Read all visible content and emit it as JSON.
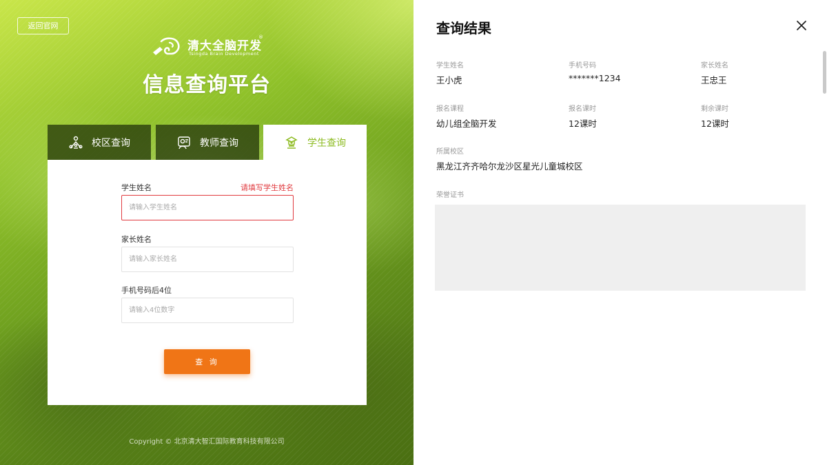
{
  "left": {
    "back_button": "返回官网",
    "logo": {
      "text": "清大全脑开发",
      "subtext": "Tsingda Brain Development",
      "reg_mark": "®"
    },
    "title": "信息查询平台",
    "tabs": [
      {
        "label": "校区查询",
        "icon": "campus-icon",
        "active": false
      },
      {
        "label": "教师查询",
        "icon": "teacher-icon",
        "active": false
      },
      {
        "label": "学生查询",
        "icon": "student-icon",
        "active": true
      }
    ],
    "form": {
      "student_name": {
        "label": "学生姓名",
        "error": "请填写学生姓名",
        "placeholder": "请输入学生姓名",
        "value": ""
      },
      "parent_name": {
        "label": "家长姓名",
        "placeholder": "请输入家长姓名",
        "value": ""
      },
      "phone_last4": {
        "label": "手机号码后4位",
        "placeholder": "请输入4位数字",
        "value": ""
      },
      "submit": "查 询"
    },
    "copyright": "Copyright ©  北京清大智汇国际教育科技有限公司"
  },
  "result": {
    "title": "查询结果",
    "close_icon": "close-icon",
    "fields": {
      "student_name": {
        "label": "学生姓名",
        "value": "王小虎"
      },
      "phone": {
        "label": "手机号码",
        "value": "*******1234"
      },
      "parent_name": {
        "label": "家长姓名",
        "value": "王忠王"
      },
      "course": {
        "label": "报名课程",
        "value": "幼儿组全脑开发"
      },
      "hours": {
        "label": "报名课时",
        "value": "12课时"
      },
      "remaining": {
        "label": "剩余课时",
        "value": "12课时"
      },
      "campus": {
        "label": "所属校区",
        "value": "黑龙江齐齐哈尔龙沙区星光儿童城校区"
      },
      "certificate": {
        "label": "荣誉证书"
      }
    }
  },
  "colors": {
    "accent_green": "#8dbb21",
    "error_red": "#e0393e",
    "button_orange": "#f07516"
  }
}
